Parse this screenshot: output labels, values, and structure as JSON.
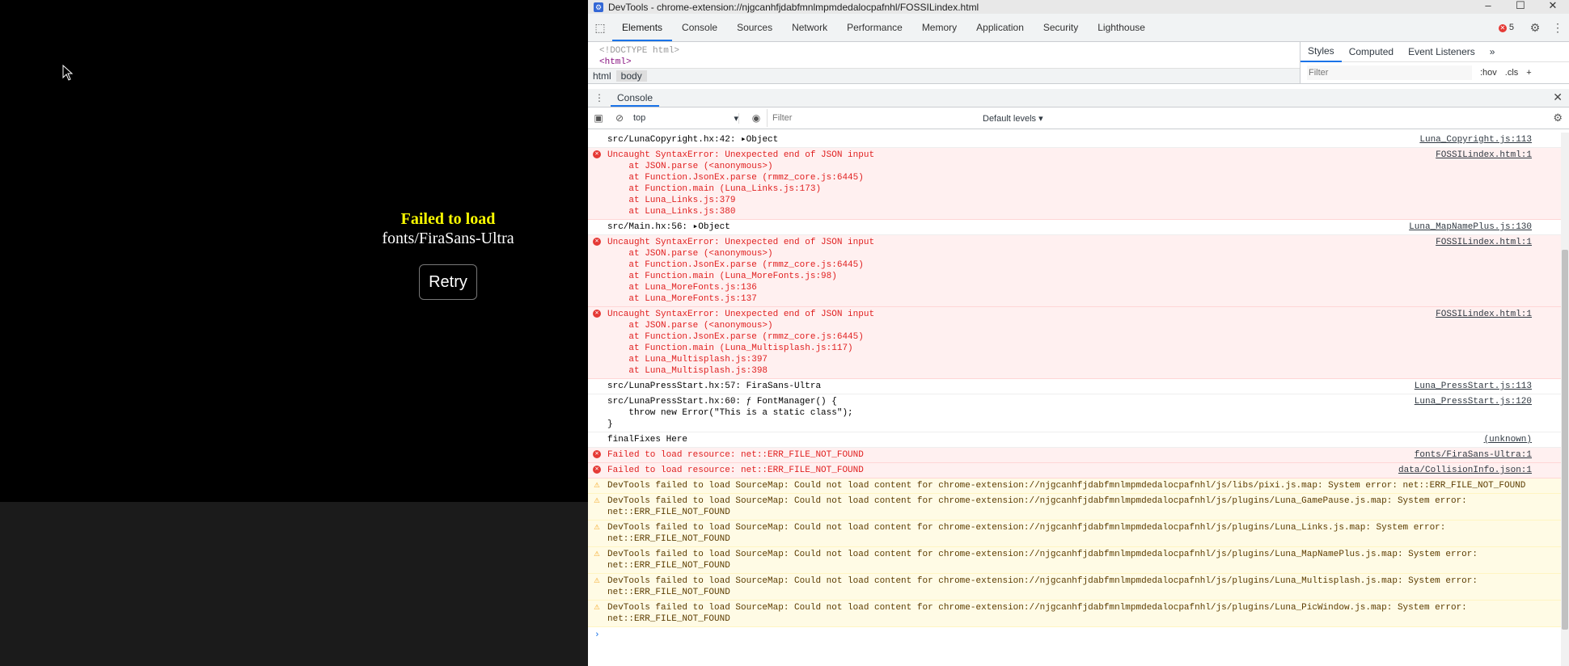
{
  "game": {
    "fail_title": "Failed to load",
    "fail_file": "fonts/FiraSans-Ultra",
    "retry_label": "Retry"
  },
  "devtools": {
    "window_title": "DevTools - chrome-extension://njgcanhfjdabfmnlmpmdedalocpafnhl/FOSSILindex.html",
    "tabs": [
      "Elements",
      "Console",
      "Sources",
      "Network",
      "Performance",
      "Memory",
      "Application",
      "Security",
      "Lighthouse"
    ],
    "error_count": "5",
    "elements": {
      "doctype": "<!DOCTYPE html>",
      "html_tag": "<html>",
      "crumbs": [
        "html",
        "body"
      ]
    },
    "styles_tabs": [
      "Styles",
      "Computed",
      "Event Listeners"
    ],
    "styles_filter_placeholder": "Filter",
    "hov": ":hov",
    "cls": ".cls",
    "drawer_tab": "Console",
    "context": "top",
    "filter_placeholder": "Filter",
    "levels": "Default levels ▾"
  },
  "console": [
    {
      "type": "log",
      "text": "src/LunaCopyright.hx:42: ▸Object",
      "source": "Luna_Copyright.js:113"
    },
    {
      "type": "error",
      "text": "Uncaught SyntaxError: Unexpected end of JSON input\n    at JSON.parse (<anonymous>)\n    at Function.JsonEx.parse (rmmz_core.js:6445)\n    at Function.main (Luna_Links.js:173)\n    at Luna_Links.js:379\n    at Luna_Links.js:380",
      "source": "FOSSILindex.html:1"
    },
    {
      "type": "log",
      "text": "src/Main.hx:56: ▸Object",
      "source": "Luna_MapNamePlus.js:130"
    },
    {
      "type": "error",
      "text": "Uncaught SyntaxError: Unexpected end of JSON input\n    at JSON.parse (<anonymous>)\n    at Function.JsonEx.parse (rmmz_core.js:6445)\n    at Function.main (Luna_MoreFonts.js:98)\n    at Luna_MoreFonts.js:136\n    at Luna_MoreFonts.js:137",
      "source": "FOSSILindex.html:1"
    },
    {
      "type": "error",
      "text": "Uncaught SyntaxError: Unexpected end of JSON input\n    at JSON.parse (<anonymous>)\n    at Function.JsonEx.parse (rmmz_core.js:6445)\n    at Function.main (Luna_Multisplash.js:117)\n    at Luna_Multisplash.js:397\n    at Luna_Multisplash.js:398",
      "source": "FOSSILindex.html:1"
    },
    {
      "type": "log",
      "text": "src/LunaPressStart.hx:57: FiraSans-Ultra",
      "source": "Luna_PressStart.js:113"
    },
    {
      "type": "log",
      "text": "src/LunaPressStart.hx:60: ƒ FontManager() {\n    throw new Error(\"This is a static class\");\n}",
      "source": "Luna_PressStart.js:120"
    },
    {
      "type": "log",
      "text": "finalFixes Here",
      "source": "(unknown)"
    },
    {
      "type": "error",
      "text": "Failed to load resource: net::ERR_FILE_NOT_FOUND",
      "source": "fonts/FiraSans-Ultra:1"
    },
    {
      "type": "error",
      "text": "Failed to load resource: net::ERR_FILE_NOT_FOUND",
      "source": "data/CollisionInfo.json:1"
    },
    {
      "type": "warn",
      "text": "DevTools failed to load SourceMap: Could not load content for chrome-extension://njgcanhfjdabfmnlmpmdedalocpafnhl/js/libs/pixi.js.map: System error: net::ERR_FILE_NOT_FOUND",
      "source": ""
    },
    {
      "type": "warn",
      "text": "DevTools failed to load SourceMap: Could not load content for chrome-extension://njgcanhfjdabfmnlmpmdedalocpafnhl/js/plugins/Luna_GamePause.js.map: System error:\nnet::ERR_FILE_NOT_FOUND",
      "source": ""
    },
    {
      "type": "warn",
      "text": "DevTools failed to load SourceMap: Could not load content for chrome-extension://njgcanhfjdabfmnlmpmdedalocpafnhl/js/plugins/Luna_Links.js.map: System error:\nnet::ERR_FILE_NOT_FOUND",
      "source": ""
    },
    {
      "type": "warn",
      "text": "DevTools failed to load SourceMap: Could not load content for chrome-extension://njgcanhfjdabfmnlmpmdedalocpafnhl/js/plugins/Luna_MapNamePlus.js.map: System error:\nnet::ERR_FILE_NOT_FOUND",
      "source": ""
    },
    {
      "type": "warn",
      "text": "DevTools failed to load SourceMap: Could not load content for chrome-extension://njgcanhfjdabfmnlmpmdedalocpafnhl/js/plugins/Luna_Multisplash.js.map: System error:\nnet::ERR_FILE_NOT_FOUND",
      "source": ""
    },
    {
      "type": "warn",
      "text": "DevTools failed to load SourceMap: Could not load content for chrome-extension://njgcanhfjdabfmnlmpmdedalocpafnhl/js/plugins/Luna_PicWindow.js.map: System error:\nnet::ERR_FILE_NOT_FOUND",
      "source": ""
    }
  ]
}
